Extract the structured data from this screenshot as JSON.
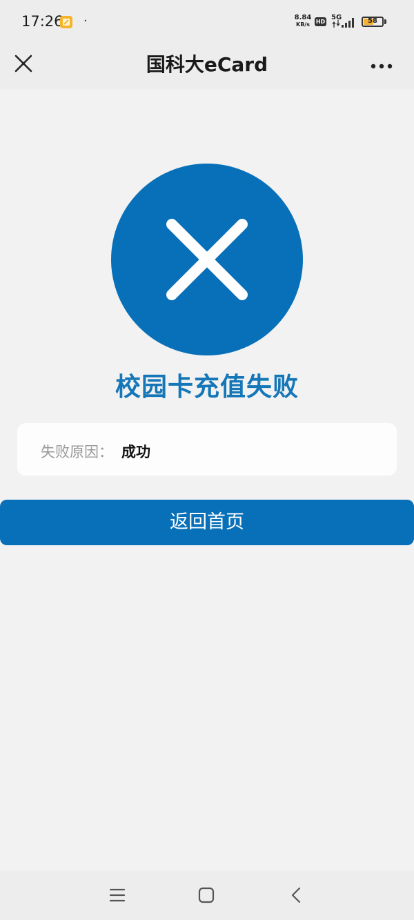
{
  "status_bar": {
    "time": "17:26",
    "dot": "·",
    "net_speed_value": "8.84",
    "net_speed_unit": "KB/s",
    "hd_label": "HD",
    "net_type": "5G",
    "battery_level": "58",
    "battery_fill_percent": 58,
    "icons": [
      "app-notification-icon",
      "signal-icon",
      "battery-icon"
    ]
  },
  "nav": {
    "title": "国科大eCard",
    "icons": [
      "close-icon",
      "more-icon"
    ]
  },
  "result": {
    "icon": "failure-cross-icon",
    "title": "校园卡充值失败",
    "reason_label": "失败原因：",
    "reason_value": "成功"
  },
  "actions": {
    "home_label": "返回首页"
  },
  "system_nav": {
    "icons": [
      "menu-icon",
      "home-icon",
      "back-icon"
    ]
  },
  "colors": {
    "accent": "#0870b8",
    "title_blue": "#1577b8",
    "background": "#f2f2f2",
    "bar_background": "#ededed",
    "battery": "#f5b131"
  }
}
